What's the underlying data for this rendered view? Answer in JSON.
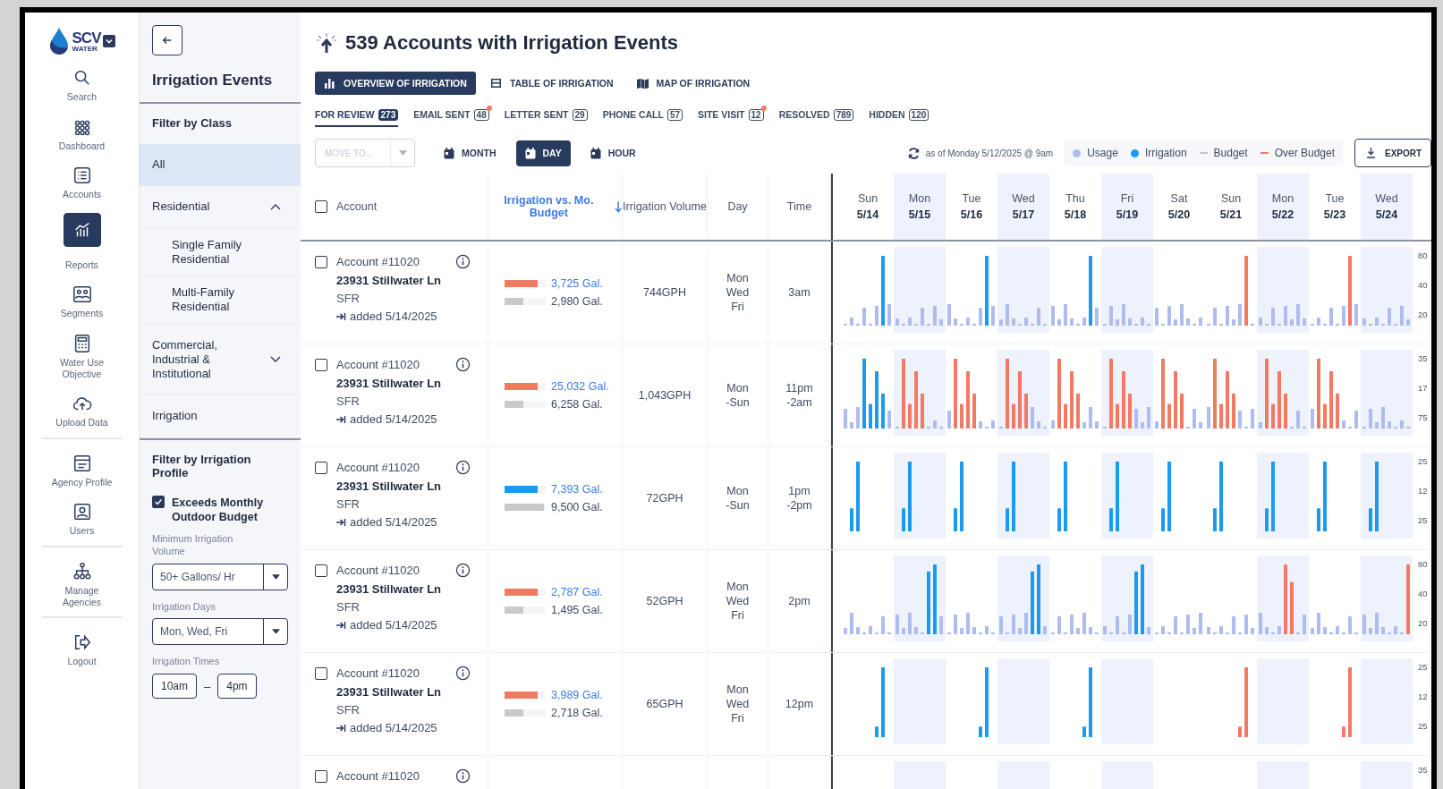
{
  "logo": {
    "name": "SCV",
    "tagline": "WATER"
  },
  "nav": [
    {
      "items": [
        {
          "label": "Search",
          "kind": "search",
          "selected": false
        },
        {
          "label": "Dashboard",
          "kind": "dashboard",
          "selected": false
        },
        {
          "label": "Accounts",
          "kind": "accounts",
          "selected": false
        },
        {
          "label": "Reports",
          "kind": "reports",
          "selected": true
        },
        {
          "label": "Segments",
          "kind": "segments",
          "selected": false
        },
        {
          "label": "Water Use Objective",
          "kind": "calculator",
          "selected": false
        },
        {
          "label": "Upload Data",
          "kind": "upload",
          "selected": false
        }
      ]
    },
    {
      "items": [
        {
          "label": "Agency Profile",
          "kind": "profile",
          "selected": false
        },
        {
          "label": "Users",
          "kind": "users",
          "selected": false
        }
      ]
    },
    {
      "items": [
        {
          "label": "Manage Agencies",
          "kind": "agencies",
          "selected": false
        }
      ]
    },
    {
      "items": [
        {
          "label": "Logout",
          "kind": "logout",
          "selected": false
        }
      ]
    }
  ],
  "filter_panel": {
    "title": "Irrigation Events",
    "class_filter": {
      "heading": "Filter by Class",
      "items": [
        {
          "label": "All",
          "selected": true
        },
        {
          "label": "Residential",
          "selected": false,
          "expanded": true,
          "children": [
            {
              "label": "Single Family Residential",
              "selected": false
            },
            {
              "label": "Multi-Family Residential",
              "selected": false
            }
          ]
        },
        {
          "label": "Commercial, Industrial & Institutional",
          "selected": false,
          "expanded": false
        },
        {
          "label": "Irrigation",
          "selected": false
        }
      ]
    },
    "profile_filter": {
      "heading": "Filter by Irrigation Profile",
      "checkbox": {
        "label": "Exceeds Monthly Outdoor Budget",
        "checked": true
      },
      "min_volume": {
        "label": "Minimum Irrigation Volume",
        "value": "50+ Gallons/ Hr"
      },
      "days": {
        "label": "Irrigation Days",
        "value": "Mon, Wed, Fri"
      },
      "times": {
        "label": "Irrigation Times",
        "from": "10am",
        "separator": "–",
        "to": "4pm"
      }
    }
  },
  "header": {
    "title": "539 Accounts with Irrigation Events"
  },
  "views": [
    {
      "label": "OVERVIEW OF IRRIGATION",
      "kind": "chart",
      "selected": true
    },
    {
      "label": "TABLE OF IRRIGATION",
      "kind": "table",
      "selected": false
    },
    {
      "label": "MAP OF IRRIGATION",
      "kind": "map",
      "selected": false
    }
  ],
  "status_tabs": [
    {
      "label": "FOR REVIEW",
      "count": "273",
      "selected": true,
      "notify": false
    },
    {
      "label": "EMAIL SENT",
      "count": "48",
      "selected": false,
      "notify": true
    },
    {
      "label": "LETTER SENT",
      "count": "29",
      "selected": false,
      "notify": false
    },
    {
      "label": "PHONE CALL",
      "count": "57",
      "selected": false,
      "notify": false
    },
    {
      "label": "SITE VISIT",
      "count": "12",
      "selected": false,
      "notify": true
    },
    {
      "label": "RESOLVED",
      "count": "789",
      "selected": false,
      "notify": false
    },
    {
      "label": "HIDDEN",
      "count": "120",
      "selected": false,
      "notify": false
    }
  ],
  "toolbar": {
    "move_to": {
      "placeholder": "MOVE TO...",
      "disabled": true
    },
    "ranges": [
      {
        "label": "MONTH",
        "selected": false
      },
      {
        "label": "DAY",
        "selected": true
      },
      {
        "label": "HOUR",
        "selected": false
      }
    ],
    "updated": "as of Monday 5/12/2025 @ 9am",
    "legend": [
      {
        "label": "Usage",
        "kind": "dot",
        "color": "#aebcf0"
      },
      {
        "label": "Irrigation",
        "kind": "dot",
        "color": "#1a9bf0"
      },
      {
        "label": "Budget",
        "kind": "dash",
        "color": "#c4c4c4"
      },
      {
        "label": "Over Budget",
        "kind": "dash",
        "color": "#f07a62"
      }
    ],
    "export": "EXPORT"
  },
  "table": {
    "select_all": {
      "checked": false
    },
    "columns": [
      {
        "label": "Account",
        "sorted": false
      },
      {
        "label": "Irrigation vs. Mo. Budget",
        "sorted": true
      },
      {
        "label": "Irrigation Volume",
        "sorted": false
      },
      {
        "label": "Day",
        "sorted": false
      },
      {
        "label": "Time",
        "sorted": false
      }
    ],
    "days": [
      {
        "weekday": "Sun",
        "date": "5/14",
        "shaded": false
      },
      {
        "weekday": "Mon",
        "date": "5/15",
        "shaded": true
      },
      {
        "weekday": "Tue",
        "date": "5/16",
        "shaded": false
      },
      {
        "weekday": "Wed",
        "date": "5/17",
        "shaded": true
      },
      {
        "weekday": "Thu",
        "date": "5/18",
        "shaded": false
      },
      {
        "weekday": "Fri",
        "date": "5/19",
        "shaded": true
      },
      {
        "weekday": "Sat",
        "date": "5/20",
        "shaded": false
      },
      {
        "weekday": "Sun",
        "date": "5/21",
        "shaded": false
      },
      {
        "weekday": "Mon",
        "date": "5/22",
        "shaded": true
      },
      {
        "weekday": "Tue",
        "date": "5/23",
        "shaded": false
      },
      {
        "weekday": "Wed",
        "date": "5/24",
        "shaded": true
      }
    ],
    "rows": [
      {
        "checked": false,
        "account": "Account #11020",
        "address": "23931 Stillwater Ln",
        "class": "SFR",
        "added": "added 5/14/2025",
        "usage": {
          "text": "3,725 Gal.",
          "level": 0.8,
          "over": true
        },
        "budget": {
          "text": "2,980 Gal.",
          "level": 0.45
        },
        "volume": "744GPH",
        "day": "Mon\nWed\nFri",
        "time": "3am",
        "ticks": [
          "80",
          "40",
          "20"
        ]
      },
      {
        "checked": false,
        "account": "Account #11020",
        "address": "23931 Stillwater Ln",
        "class": "SFR",
        "added": "added 5/14/2025",
        "usage": {
          "text": "25,032 Gal.",
          "level": 0.8,
          "over": true
        },
        "budget": {
          "text": "6,258 Gal.",
          "level": 0.45
        },
        "volume": "1,043GPH",
        "day": "Mon\n-Sun",
        "time": "11pm\n-2am",
        "ticks": [
          "35",
          "17",
          "75"
        ]
      },
      {
        "checked": false,
        "account": "Account #11020",
        "address": "23931 Stillwater Ln",
        "class": "SFR",
        "added": "added 5/14/2025",
        "usage": {
          "text": "7,393 Gal.",
          "level": 0.8,
          "over": false
        },
        "budget": {
          "text": "9,500 Gal.",
          "level": 0.95
        },
        "volume": "72GPH",
        "day": "Mon\n-Sun",
        "time": "1pm\n-2pm",
        "ticks": [
          "25",
          "12",
          "25"
        ]
      },
      {
        "checked": false,
        "account": "Account #11020",
        "address": "23931 Stillwater Ln",
        "class": "SFR",
        "added": "added 5/14/2025",
        "usage": {
          "text": "2,787 Gal.",
          "level": 0.8,
          "over": true
        },
        "budget": {
          "text": "1,495 Gal.",
          "level": 0.45
        },
        "volume": "52GPH",
        "day": "Mon\nWed\nFri",
        "time": "2pm",
        "ticks": [
          "80",
          "40",
          "20"
        ]
      },
      {
        "checked": false,
        "account": "Account #11020",
        "address": "23931 Stillwater Ln",
        "class": "SFR",
        "added": "added 5/14/2025",
        "usage": {
          "text": "3,989 Gal.",
          "level": 0.8,
          "over": true
        },
        "budget": {
          "text": "2,718 Gal.",
          "level": 0.45
        },
        "volume": "65GPH",
        "day": "Mon\nWed\nFri",
        "time": "12pm",
        "ticks": [
          "25",
          "12",
          "25"
        ]
      },
      {
        "checked": false,
        "account": "Account #11020",
        "ticks": [
          "35"
        ]
      }
    ]
  }
}
